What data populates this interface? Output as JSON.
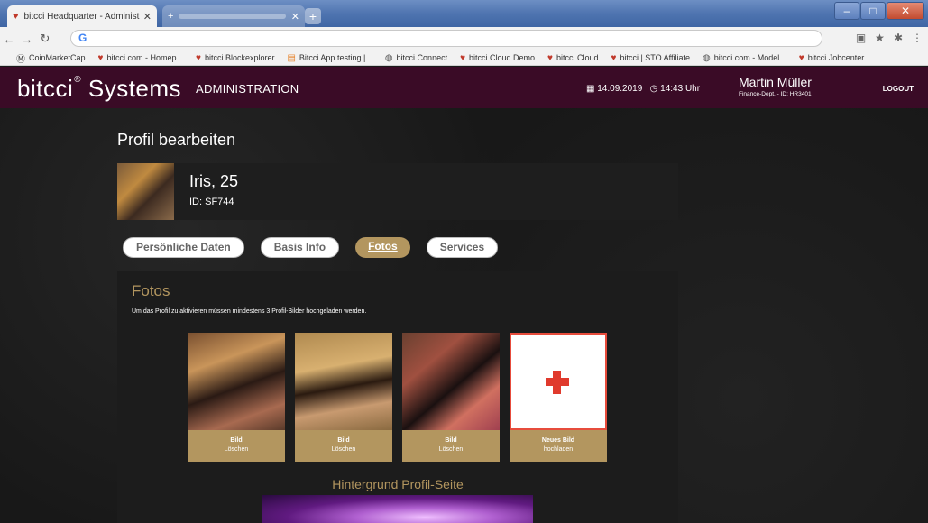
{
  "browser": {
    "active_tab_title": "bitcci Headquarter - Administrati",
    "address_text": "G",
    "bookmarks": [
      {
        "label": "CoinMarketCap",
        "icon": "coinmarketcap-icon"
      },
      {
        "label": "bitcci.com - Homep...",
        "icon": "heart-icon"
      },
      {
        "label": "bitcci Blockexplorer",
        "icon": "heart-icon"
      },
      {
        "label": "Bitcci App testing |...",
        "icon": "app-icon"
      },
      {
        "label": "bitcci Connect",
        "icon": "globe-icon"
      },
      {
        "label": "bitcci Cloud Demo",
        "icon": "heart-icon"
      },
      {
        "label": "bitcci Cloud",
        "icon": "heart-icon"
      },
      {
        "label": "bitcci | STO Affiliate",
        "icon": "heart-icon"
      },
      {
        "label": "bitcci.com - Model...",
        "icon": "globe-icon"
      },
      {
        "label": "bitcci Jobcenter",
        "icon": "heart-icon"
      }
    ]
  },
  "header": {
    "logo_main": "bitcci",
    "logo_suffix": "Systems",
    "section": "ADMINISTRATION",
    "date": "14.09.2019",
    "time": "14:43 Uhr",
    "user_name": "Martin Müller",
    "user_dept": "Finance-Dept. - ID: HR3401",
    "logout": "LOGOUT",
    "bg_color": "#3a0b26"
  },
  "page": {
    "title": "Profil bearbeiten",
    "profile_name": "Iris, 25",
    "profile_id": "ID: SF744"
  },
  "tabs": [
    {
      "label": "Persönliche Daten",
      "active": false
    },
    {
      "label": "Basis Info",
      "active": false
    },
    {
      "label": "Fotos",
      "active": true
    },
    {
      "label": "Services",
      "active": false
    }
  ],
  "fotos": {
    "title": "Fotos",
    "note": "Um das Profil zu aktivieren müssen mindestens 3 Profil-Bilder hochgeladen werden.",
    "photos": [
      {
        "caption": "Bild",
        "action": "Löschen"
      },
      {
        "caption": "Bild",
        "action": "Löschen"
      },
      {
        "caption": "Bild",
        "action": "Löschen"
      }
    ],
    "new_image": {
      "caption": "Neues Bild",
      "action": "hochladen"
    },
    "background_title": "Hintergrund Profil-Seite",
    "accent_color": "#b3965f"
  }
}
